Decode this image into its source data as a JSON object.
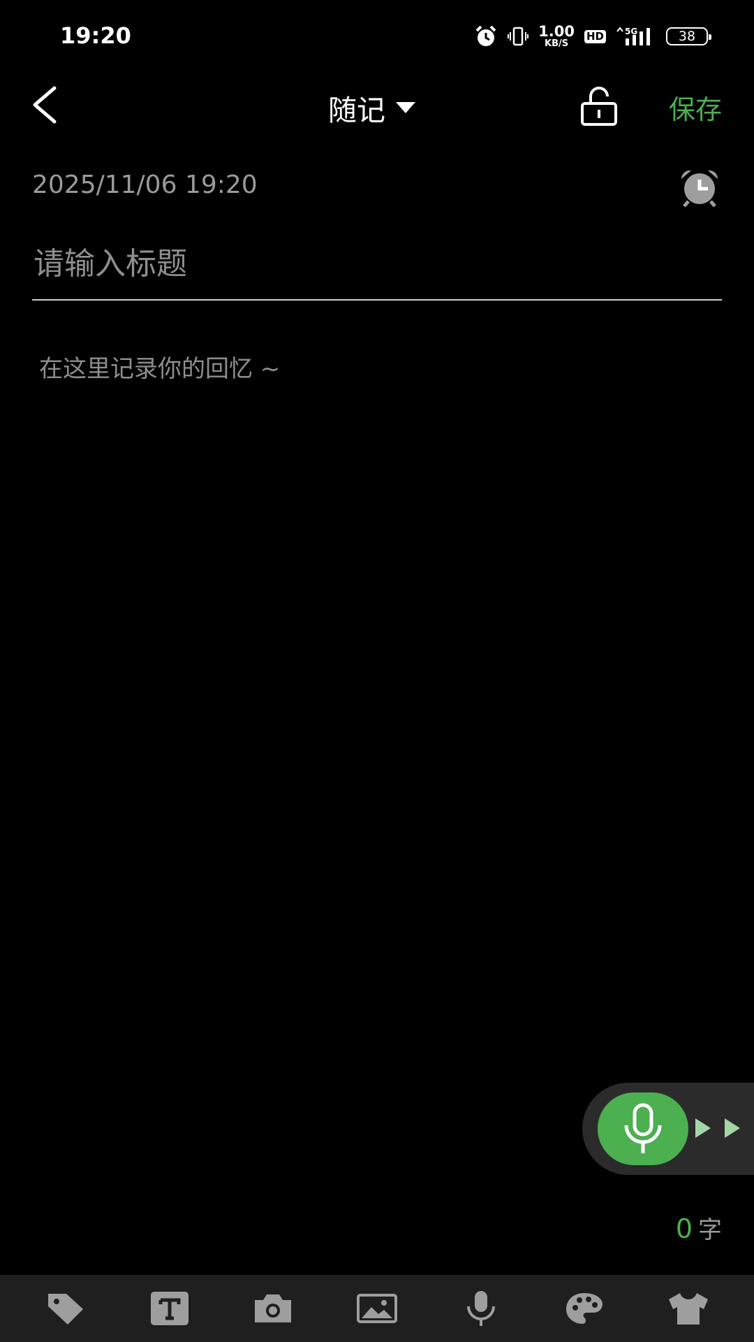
{
  "status_bar": {
    "time": "19:20",
    "net_speed_value": "1.00",
    "net_speed_unit": "KB/S",
    "hd_label": "HD",
    "network_label": "5G",
    "battery_level": "38"
  },
  "header": {
    "title": "随记",
    "save_label": "保存"
  },
  "note": {
    "date": "2025/11/06 19:20",
    "title_placeholder": "请输入标题",
    "title_value": "",
    "body_placeholder": "在这里记录你的回忆 ~",
    "body_value": ""
  },
  "word_count": {
    "count": "0",
    "unit": "字"
  },
  "toolbar": {
    "items": [
      "tag-icon",
      "text-format-icon",
      "camera-icon",
      "image-icon",
      "microphone-icon",
      "palette-icon",
      "shirt-icon"
    ]
  },
  "colors": {
    "accent": "#4caf50",
    "background": "#000000",
    "toolbar_background": "#1f1f1f",
    "muted_text": "#9a9a9a"
  }
}
